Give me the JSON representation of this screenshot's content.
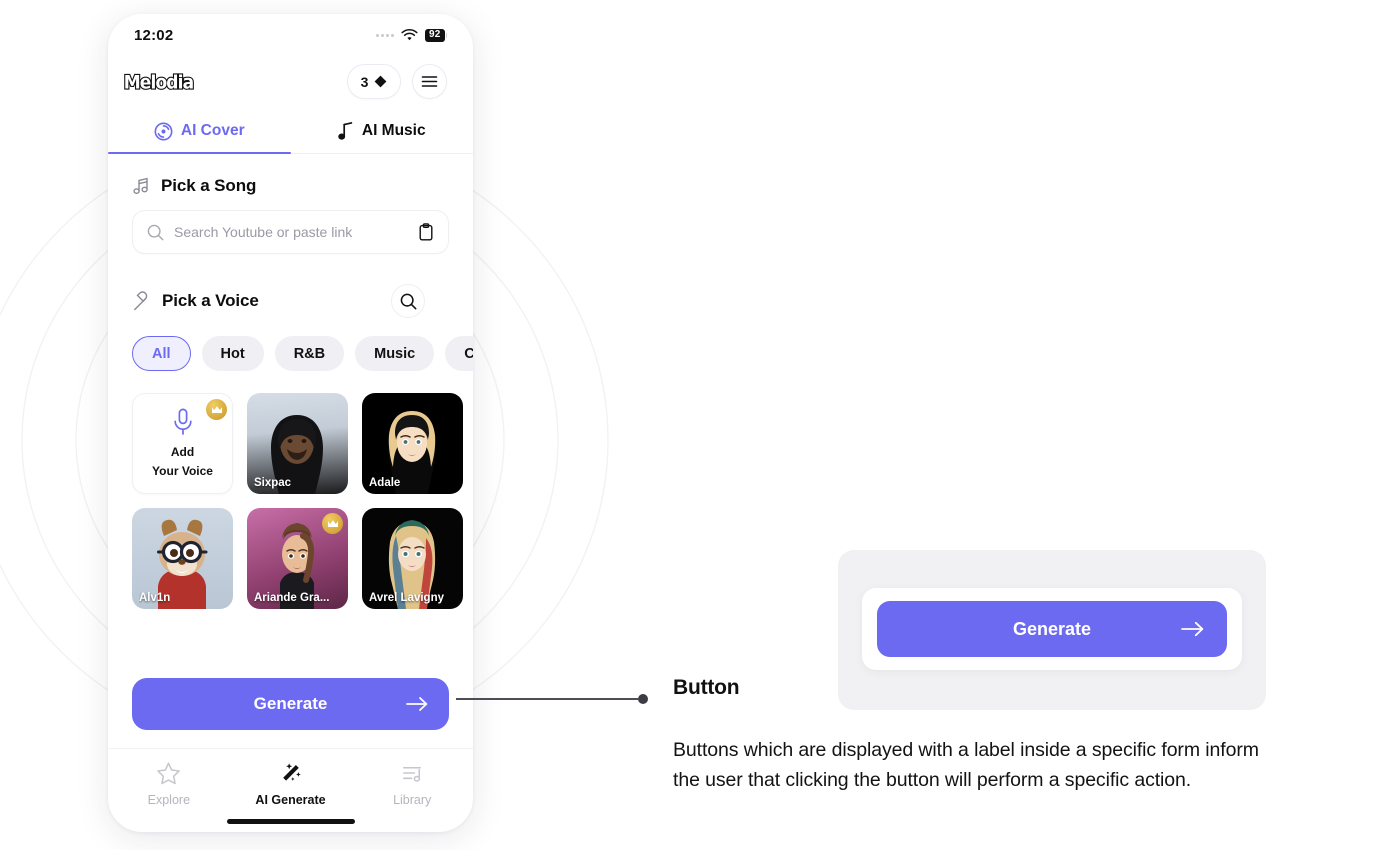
{
  "phone": {
    "status_bar": {
      "time": "12:02",
      "battery": "92",
      "wifi_icon": "wifi-icon",
      "signal_icon": "signal-dots-icon"
    },
    "app_bar": {
      "logo_text": "Melodia",
      "credits": "3",
      "credits_icon": "diamond-icon",
      "menu_icon": "hamburger-menu-icon"
    },
    "tabs": [
      {
        "label": "AI Cover",
        "icon": "vinyl-disc-icon",
        "active": true
      },
      {
        "label": "AI Music",
        "icon": "music-note-icon",
        "active": false
      }
    ],
    "pick_song": {
      "title": "Pick a Song",
      "icon": "music-notes-icon",
      "search_placeholder": "Search Youtube or paste link",
      "search_value": "",
      "search_icon": "search-icon",
      "paste_icon": "clipboard-icon"
    },
    "pick_voice": {
      "title": "Pick a Voice",
      "icon": "microphone-icon",
      "search_icon": "search-icon",
      "categories": [
        {
          "label": "All",
          "active": true
        },
        {
          "label": "Hot",
          "active": false
        },
        {
          "label": "R&B",
          "active": false
        },
        {
          "label": "Music",
          "active": false
        },
        {
          "label": "Cartoon",
          "active": false
        }
      ],
      "voices": [
        {
          "name": "Add\nYour Voice",
          "type": "add",
          "premium": true,
          "icon": "microphone-icon"
        },
        {
          "name": "Sixpac",
          "type": "avatar",
          "premium": false
        },
        {
          "name": "Adale",
          "type": "avatar",
          "premium": false
        },
        {
          "name": "Alv1n",
          "type": "avatar",
          "premium": false
        },
        {
          "name": "Ariande Gra...",
          "type": "avatar",
          "premium": true
        },
        {
          "name": "Avrel Lavigny",
          "type": "avatar",
          "premium": false
        }
      ],
      "add_voice_line1": "Add",
      "add_voice_line2": "Your Voice"
    },
    "generate_button": {
      "label": "Generate",
      "arrow_icon": "arrow-right-icon"
    },
    "bottom_nav": [
      {
        "label": "Explore",
        "icon": "star-icon",
        "active": false
      },
      {
        "label": "AI Generate",
        "icon": "magic-wand-icon",
        "active": true
      },
      {
        "label": "Library",
        "icon": "library-list-icon",
        "active": false
      }
    ]
  },
  "annotation": {
    "title": "Button",
    "body": "Buttons which are displayed with a label inside a specific form inform the user that clicking the button will perform a specific action.",
    "demo_button_label": "Generate",
    "demo_button_arrow_icon": "arrow-right-icon"
  },
  "colors": {
    "accent": "#6C6AF0",
    "chip_bg": "#F0F0F4",
    "card_bg": "#F1F1F4",
    "text": "#111111",
    "muted": "#B5B5BD"
  }
}
